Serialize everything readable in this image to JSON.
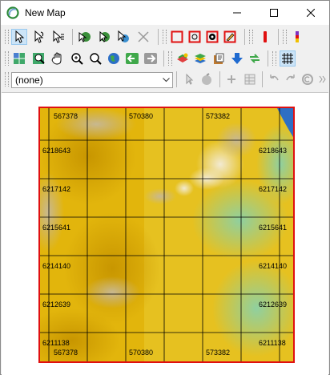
{
  "window": {
    "title": "New Map"
  },
  "colors": {
    "frame": "#e01010",
    "title_bg": "#ffffff",
    "terrain_low": "#d9a400",
    "terrain_mid": "#e7c21b",
    "terrain_high": "#ece2b8",
    "water": "#2e6fc4",
    "green_zone": "#7fcf9a"
  },
  "toolbar": {
    "row1_icons": [
      "select-arrow-icon",
      "select-lasso-icon",
      "select-multi-icon",
      "identify-globe-icon",
      "identify-arrow-icon",
      "identify-feature-icon",
      "delete-x-icon",
      "frame-square-icon",
      "frame-zoom-icon",
      "frame-gear-icon",
      "frame-edit-icon",
      "red-bar-icon",
      "colorbar-icon"
    ],
    "row2_icons": [
      "layers-grid-icon",
      "zoom-window-icon",
      "pan-hand-icon",
      "zoom-in-icon",
      "zoom-out-icon",
      "full-extent-globe-icon",
      "back-arrow-icon",
      "forward-arrow-icon",
      "add-data-icon",
      "layer-stack-icon",
      "clipboard-icon",
      "download-arrow-icon",
      "refresh-arrows-icon",
      "grid-icon"
    ],
    "row3_icons": [
      "select-tool-icon",
      "paint-tool-icon",
      "plus-icon",
      "table-icon",
      "undo-icon",
      "redo-icon",
      "copy-icon",
      "grip-icon"
    ]
  },
  "layer_combo": {
    "value": "(none)"
  },
  "map": {
    "x_labels_top": [
      "567378",
      "570380",
      "573382"
    ],
    "x_labels_bottom": [
      "567378",
      "570380",
      "573382"
    ],
    "y_labels_left": [
      "6218643",
      "6217142",
      "6215641",
      "6214140",
      "6212639",
      "6211138"
    ],
    "y_labels_right": [
      "6218643",
      "6217142",
      "6215641",
      "6214140",
      "6212639",
      "6211138"
    ]
  }
}
